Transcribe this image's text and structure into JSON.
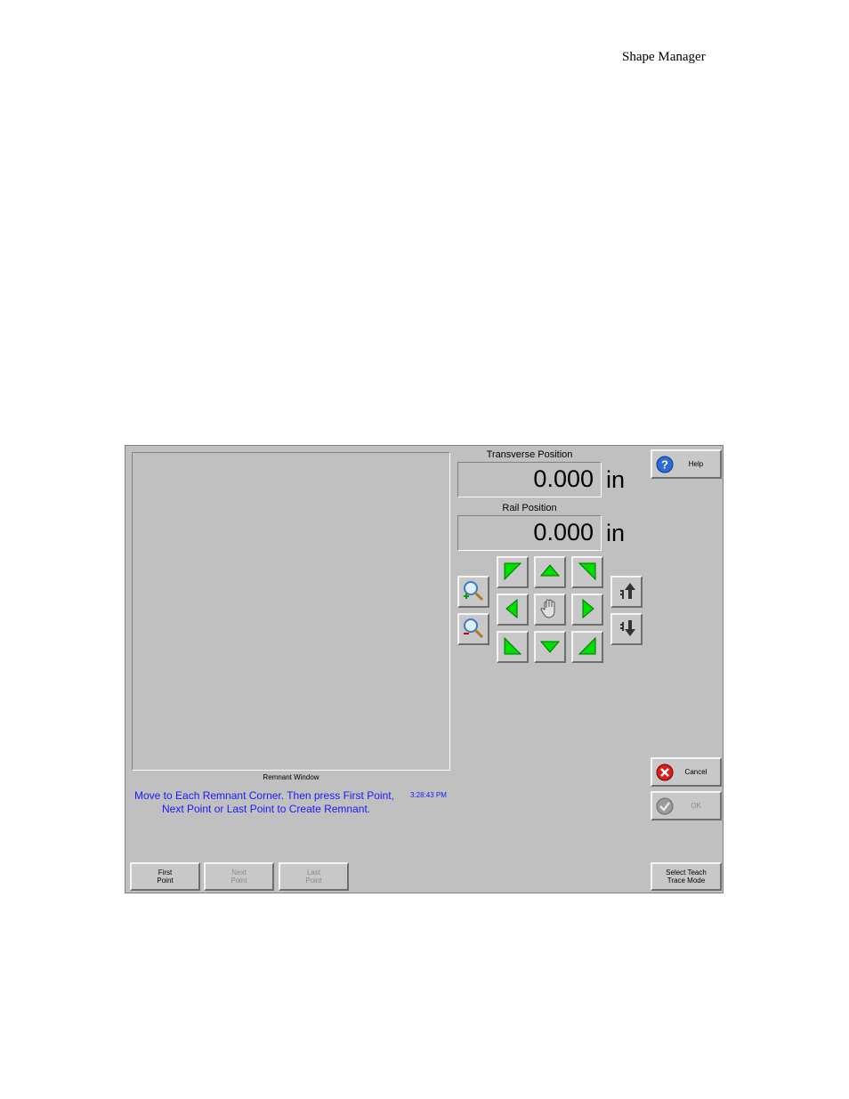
{
  "page_header": "Shape Manager",
  "remnant": {
    "window_label": "Remnant Window",
    "message_line1": "Move to Each Remnant Corner. Then press First Point,",
    "message_line2": "Next Point or Last Point to Create Remnant.",
    "timestamp": "3:28:43 PM"
  },
  "positions": {
    "transverse": {
      "label": "Transverse Position",
      "value": "0.000",
      "unit": "in"
    },
    "rail": {
      "label": "Rail Position",
      "value": "0.000",
      "unit": "in"
    }
  },
  "buttons": {
    "help": "Help",
    "cancel": "Cancel",
    "ok": "OK",
    "first_point": [
      "First",
      "Point"
    ],
    "next_point": [
      "Next",
      "Point"
    ],
    "last_point": [
      "Last",
      "Point"
    ],
    "select_teach": [
      "Select Teach",
      "Trace Mode"
    ]
  },
  "icons": {
    "zoom_in": "zoom-in-icon",
    "zoom_out": "zoom-out-icon",
    "jog_arrows": "green",
    "hand": "hand-icon",
    "speed_up": "speed-up-icon",
    "speed_down": "speed-down-icon"
  },
  "colors": {
    "panel": "#c0c0c0",
    "message_text": "#1a1aff",
    "jog_arrow": "#00e000"
  }
}
